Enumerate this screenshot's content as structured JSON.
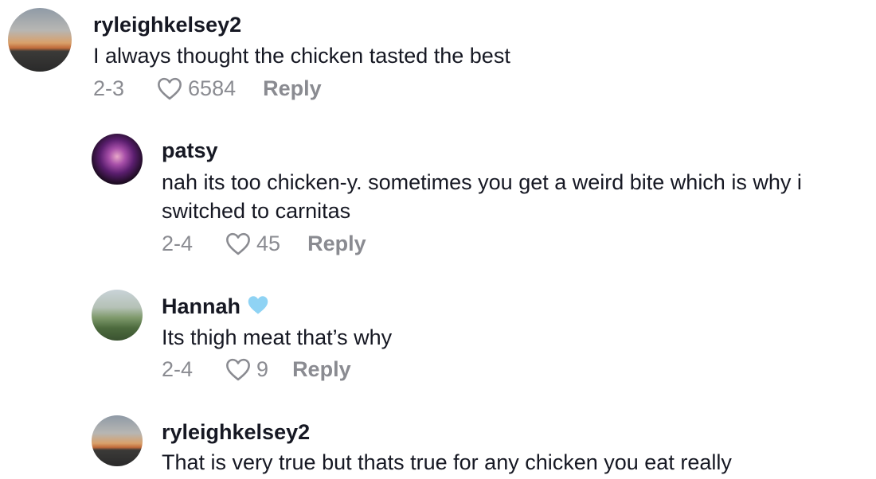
{
  "comments": [
    {
      "username": "ryleighkelsey2",
      "text": "I always thought the chicken tasted the best",
      "date": "2-3",
      "likes": "6584",
      "reply_label": "Reply"
    },
    {
      "username": "patsy",
      "text": "nah its too chicken-y. sometimes you get a weird bite which is why i switched to carnitas",
      "date": "2-4",
      "likes": "45",
      "reply_label": "Reply"
    },
    {
      "username": "Hannah",
      "badge_icon": "light-blue-heart-emoji",
      "text": "Its thigh meat that’s why",
      "date": "2-4",
      "likes": "9",
      "reply_label": "Reply"
    },
    {
      "username": "ryleighkelsey2",
      "text": "That is very true but thats true for any chicken you eat really"
    }
  ],
  "colors": {
    "primary_text": "#161823",
    "secondary_text": "#8a8b91",
    "heart_badge": "#8fd3f4"
  }
}
